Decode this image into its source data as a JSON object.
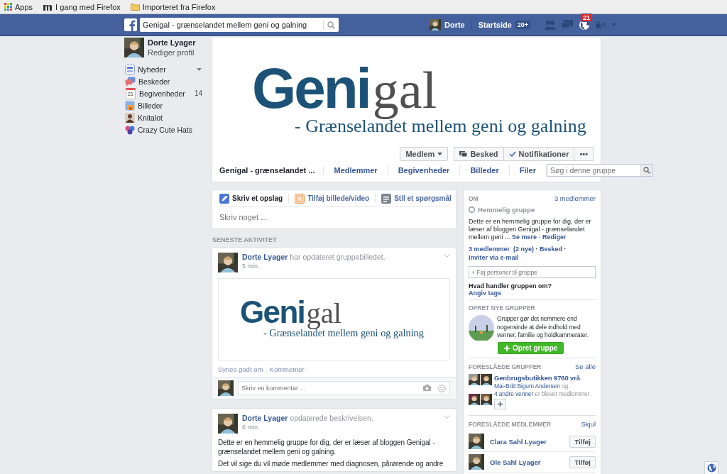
{
  "bookmarks": [
    {
      "label": "Apps"
    },
    {
      "label": "I gang med Firefox"
    },
    {
      "label": "Importeret fra Firefox"
    }
  ],
  "topbar": {
    "search_value": "Genigal - grænselandet mellem geni og galning",
    "user": "Dorte",
    "home": "Startside",
    "home_count": "20+",
    "notification_count": "21"
  },
  "sidebar": {
    "name": "Dorte Lyager",
    "edit": "Rediger profil",
    "items": [
      {
        "label": "Nyheder",
        "has_menu": true
      },
      {
        "label": "Beskeder",
        "has_menu": false
      },
      {
        "label": "Begivenheder",
        "icon_text": "21",
        "count": "14",
        "has_menu": false
      },
      {
        "label": "Billeder",
        "has_menu": false
      },
      {
        "label": "Knitalot",
        "has_menu": false
      },
      {
        "label": "Crazy Cute Hats",
        "has_menu": false
      }
    ]
  },
  "cover": {
    "logo_bold": "Geni",
    "logo_rest": "gal",
    "tagline": "- Grænselandet mellem geni og galning",
    "buttons": [
      {
        "label": "Medlem",
        "kind": "dropdown"
      },
      {
        "label": "Besked",
        "kind": "message"
      },
      {
        "label": "Notifikationer",
        "kind": "check"
      },
      {
        "label": "•••",
        "kind": "more"
      }
    ]
  },
  "group_nav": {
    "name": "Genigal - grænselandet ...",
    "tabs": [
      "Medlemmer",
      "Begivenheder",
      "Billeder",
      "Filer"
    ],
    "search_placeholder": "Søg i denne gruppe"
  },
  "composer": {
    "tabs": [
      {
        "label": "Skriv et opslag",
        "selected": true
      },
      {
        "label": "Tilføj billede/video",
        "selected": false
      },
      {
        "label": "Stil et spørgsmål",
        "selected": false
      }
    ],
    "placeholder": "Skriv noget ..."
  },
  "feed_heading": "SENESTE AKTIVITET",
  "posts": [
    {
      "author": "Dorte Lyager",
      "action": "har opdateret gruppebilledet.",
      "time": "5 min.",
      "attachment": {
        "logo_bold": "Geni",
        "logo_rest": "gal",
        "tagline": "- Grænselandet mellem geni og galning"
      },
      "actions": [
        "Synes godt om",
        "Kommenter"
      ],
      "separator": "·",
      "comment_placeholder": "Skriv en kommentar ..."
    },
    {
      "author": "Dorte Lyager",
      "action": "opdaterede beskrivelsen.",
      "time": "6 min.",
      "paragraphs": [
        "Dette er en hemmelig gruppe for dig, der er læser af bloggen Genigal - grænselandet mellem geni og galning.",
        "Det vil sige du vil møde medlemmer med diagnosen, pårørende og andre"
      ]
    }
  ],
  "about": {
    "heading": "OM",
    "member_count": "3 medlemmer",
    "privacy": "Hemmelig gruppe",
    "description": "Dette er en hemmelig gruppe for dig, der er læser af bloggen Genigal - grænselandet mellem geni ...",
    "see_more": "Se mere",
    "edit": "Rediger",
    "separator": "·",
    "links": [
      "3 medlemmer  (2 nye)",
      "Besked",
      "Inviter via e-mail"
    ],
    "add_placeholder": "+ Føj personer til gruppe",
    "tags_question": "Hvad handler gruppen om?",
    "tags_link": "Angiv tags"
  },
  "create_group": {
    "heading": "OPRET NYE GRUPPER",
    "text": "Grupper gør det nemmere end nogensinde at dele indhold med venner, familie og holdkammerater.",
    "button": "Opret gruppe"
  },
  "suggested_groups": {
    "heading": "FORESLÅEDE GRUPPER",
    "see_all": "Se alle",
    "items": [
      {
        "name": "Genbrugsbutikken 9760 vrå",
        "friend": "Mai-Britt Bigum Andersen",
        "connector": "og",
        "others": "4 andre venner",
        "tail": "er blevet medlemmer"
      }
    ]
  },
  "suggested_members": {
    "heading": "FORESLÅEDE MEDLEMMER",
    "hide": "Skjul",
    "items": [
      {
        "name": "Clara Sahl Lyager",
        "button": "Tilføj"
      },
      {
        "name": "Ole Sahl Lyager",
        "button": "Tilføj"
      }
    ]
  }
}
